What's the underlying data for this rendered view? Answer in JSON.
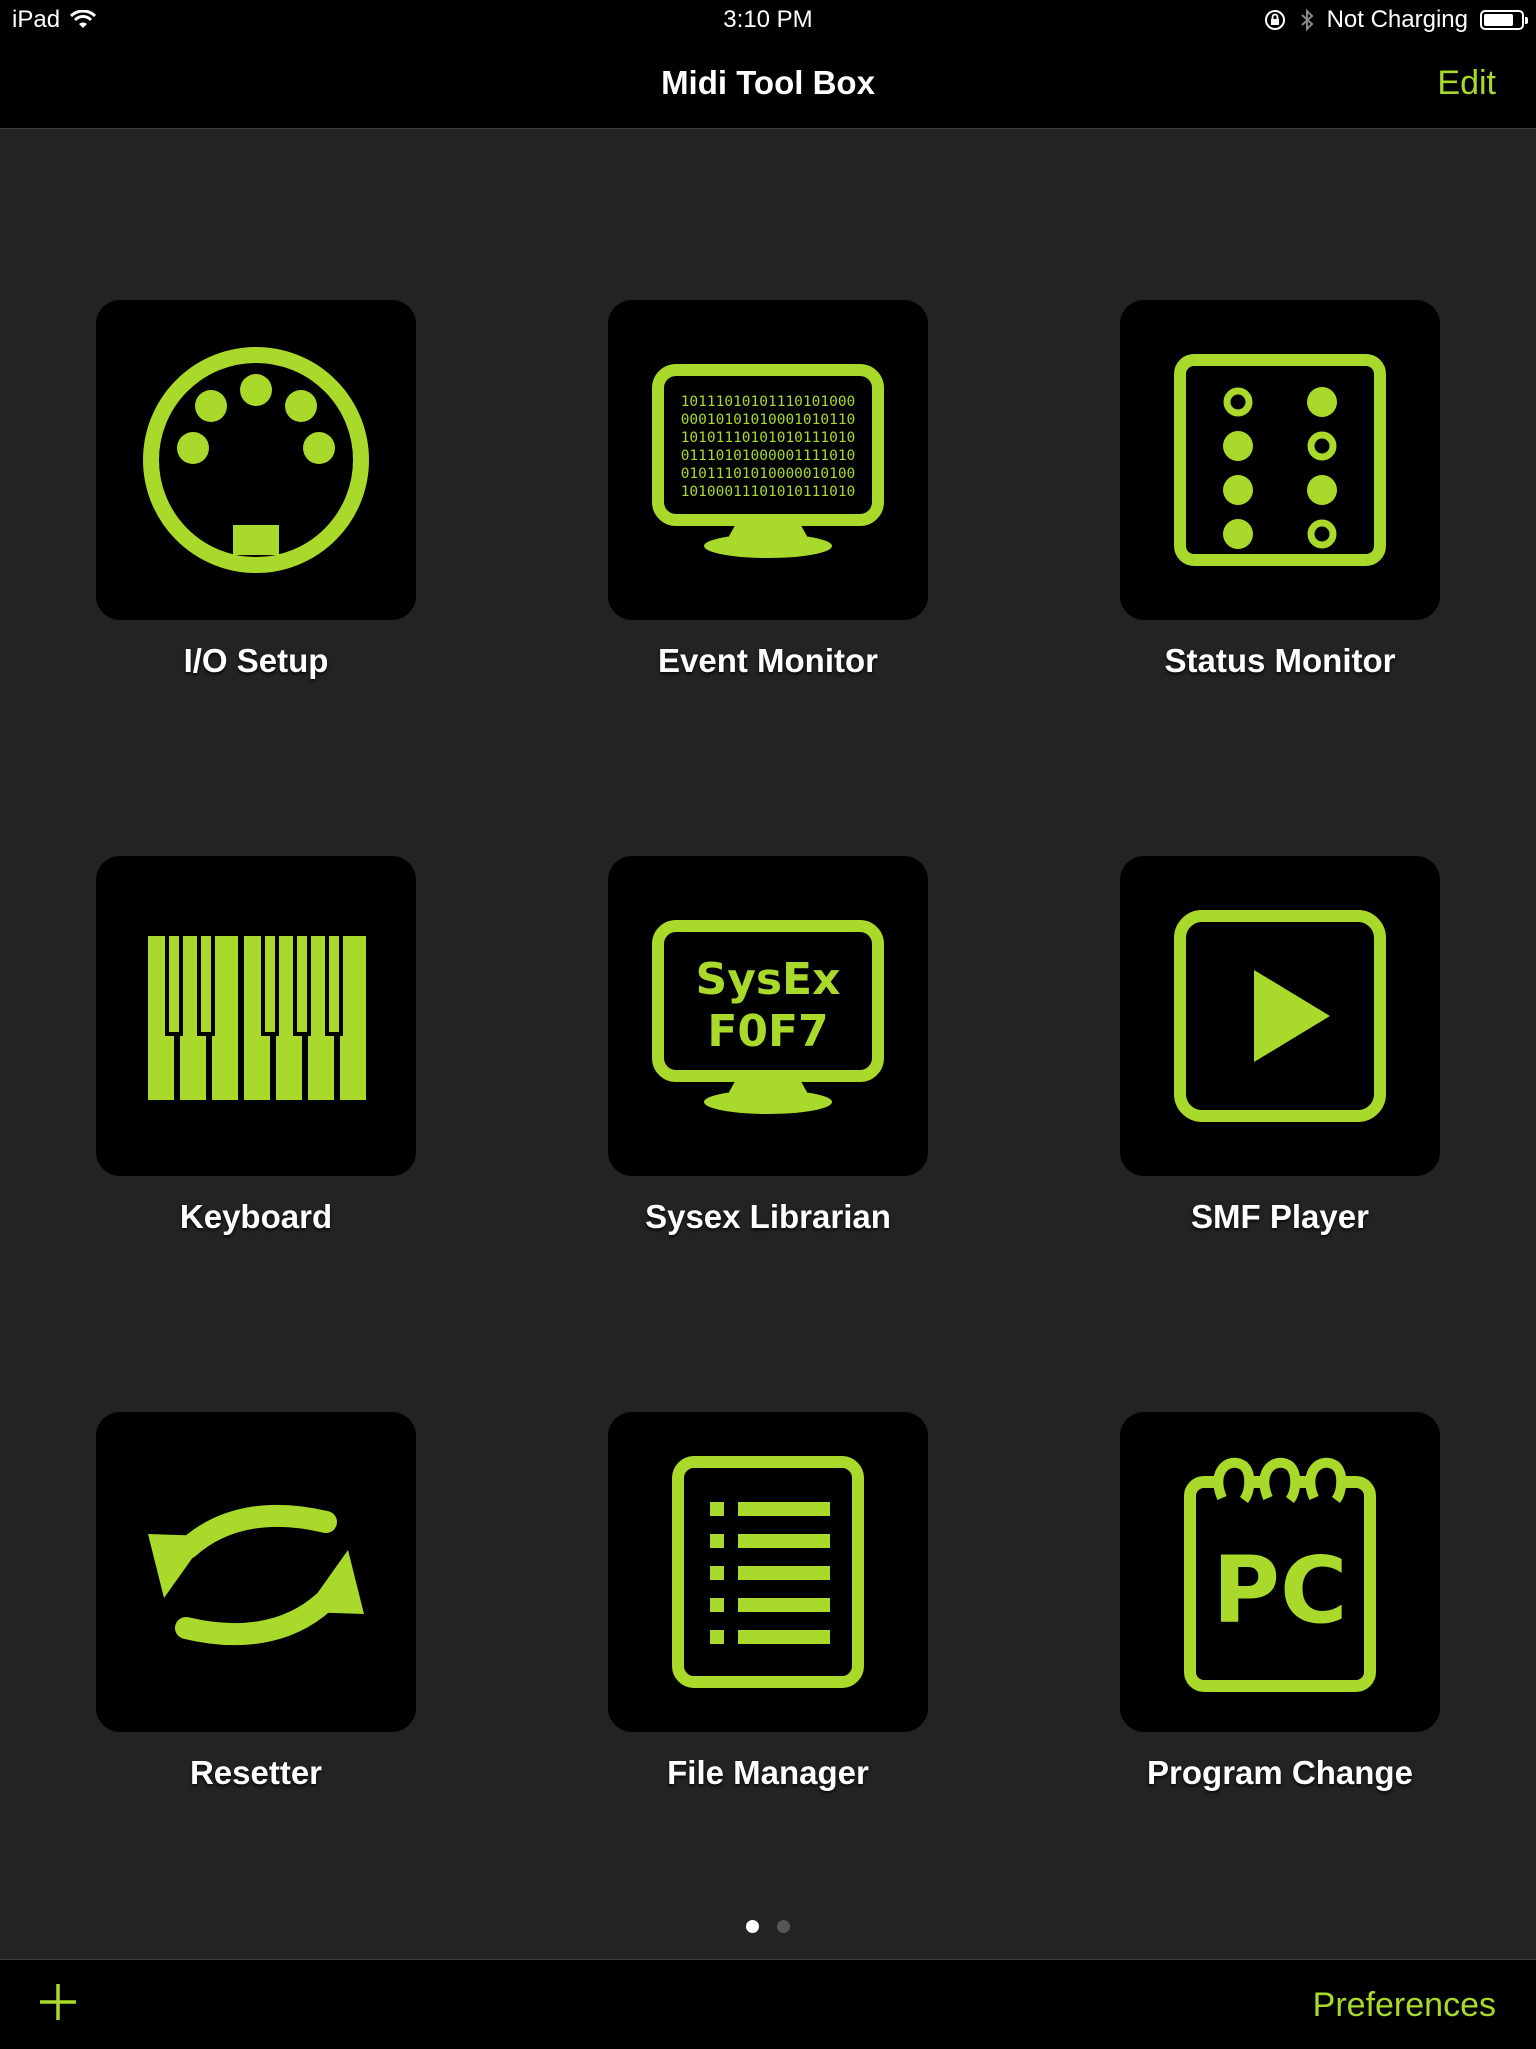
{
  "status_bar": {
    "device": "iPad",
    "time": "3:10 PM",
    "charging": "Not Charging",
    "battery_level": 0.8
  },
  "nav": {
    "title": "Midi Tool Box",
    "edit_label": "Edit"
  },
  "accent_color": "#a8d92b",
  "tiles": [
    {
      "label": "I/O Setup",
      "icon": "midi-din-connector-icon"
    },
    {
      "label": "Event Monitor",
      "icon": "binary-monitor-icon",
      "icon_text": [
        "10111010101110101000",
        "00010101010001010110",
        "10101110101010111010",
        "01110101000001111010",
        "01011101010000010100",
        "10100011101010111010"
      ]
    },
    {
      "label": "Status Monitor",
      "icon": "status-lights-icon"
    },
    {
      "label": "Keyboard",
      "icon": "piano-keys-icon"
    },
    {
      "label": "Sysex Librarian",
      "icon": "sysex-monitor-icon",
      "icon_text": [
        "SysEx",
        "F0F7"
      ]
    },
    {
      "label": "SMF Player",
      "icon": "play-icon"
    },
    {
      "label": "Resetter",
      "icon": "reset-arrows-icon"
    },
    {
      "label": "File Manager",
      "icon": "file-list-icon"
    },
    {
      "label": "Program Change",
      "icon": "notepad-pc-icon",
      "icon_text": [
        "PC"
      ]
    }
  ],
  "page_indicator": {
    "pages": 2,
    "current": 1
  },
  "toolbar": {
    "add_icon": "plus-icon",
    "preferences_label": "Preferences"
  }
}
